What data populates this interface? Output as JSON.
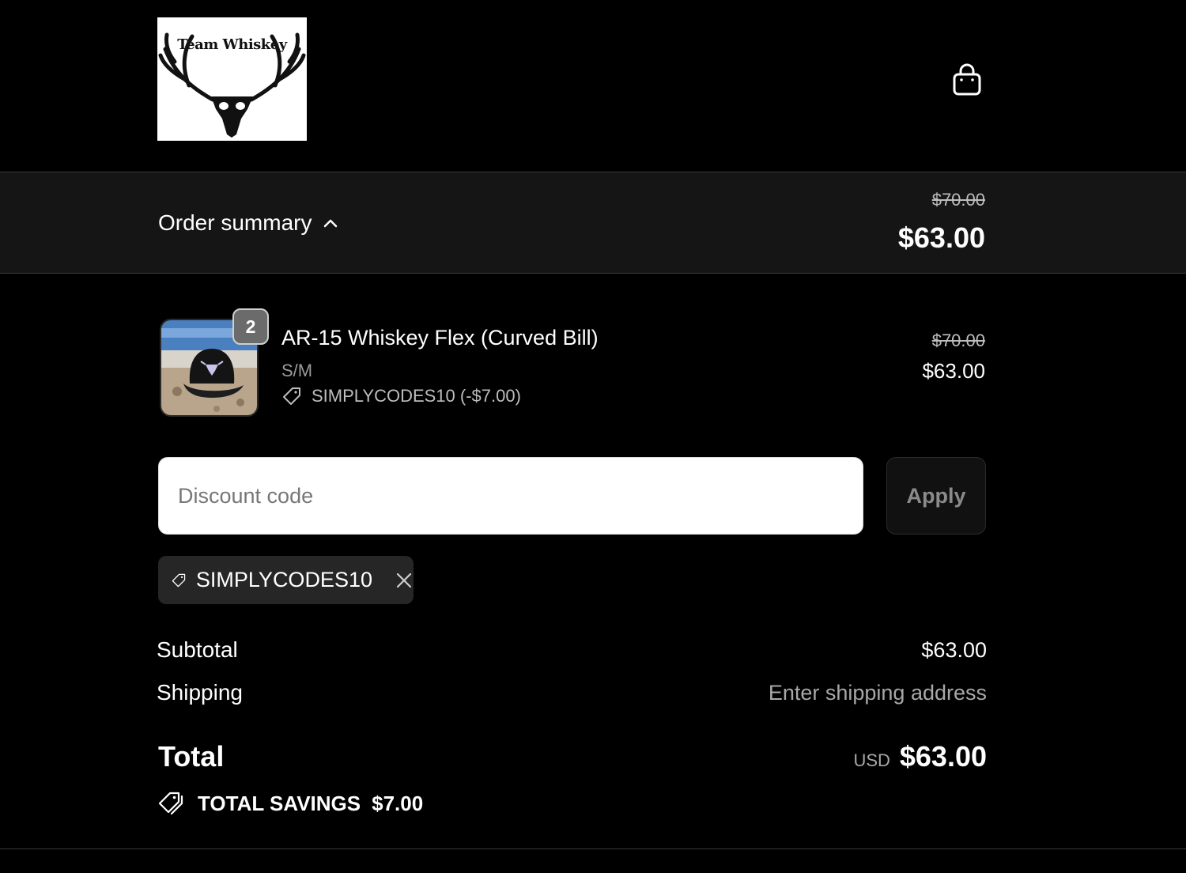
{
  "header": {
    "logo_text": "Team Whiskey",
    "cart_icon": "shopping-bag-icon"
  },
  "summary": {
    "toggle_label": "Order summary",
    "toggle_icon": "chevron-up-icon",
    "original_total": "$70.00",
    "total": "$63.00"
  },
  "item": {
    "quantity": "2",
    "title": "AR-15 Whiskey Flex (Curved Bill)",
    "variant": "S/M",
    "discount_line": "SIMPLYCODES10 (-$7.00)",
    "original_price": "$70.00",
    "price": "$63.00"
  },
  "discount": {
    "placeholder": "Discount code",
    "value": "",
    "apply_label": "Apply",
    "applied_code": "SIMPLYCODES10"
  },
  "totals": {
    "subtotal_label": "Subtotal",
    "subtotal_value": "$63.00",
    "shipping_label": "Shipping",
    "shipping_value": "Enter shipping address",
    "total_label": "Total",
    "currency": "USD",
    "total_value": "$63.00",
    "savings_label": "TOTAL SAVINGS",
    "savings_value": "$7.00"
  },
  "colors": {
    "background": "#000000",
    "summary_bar": "#151515",
    "chip": "#262626",
    "muted_text": "#a8a8a8"
  }
}
